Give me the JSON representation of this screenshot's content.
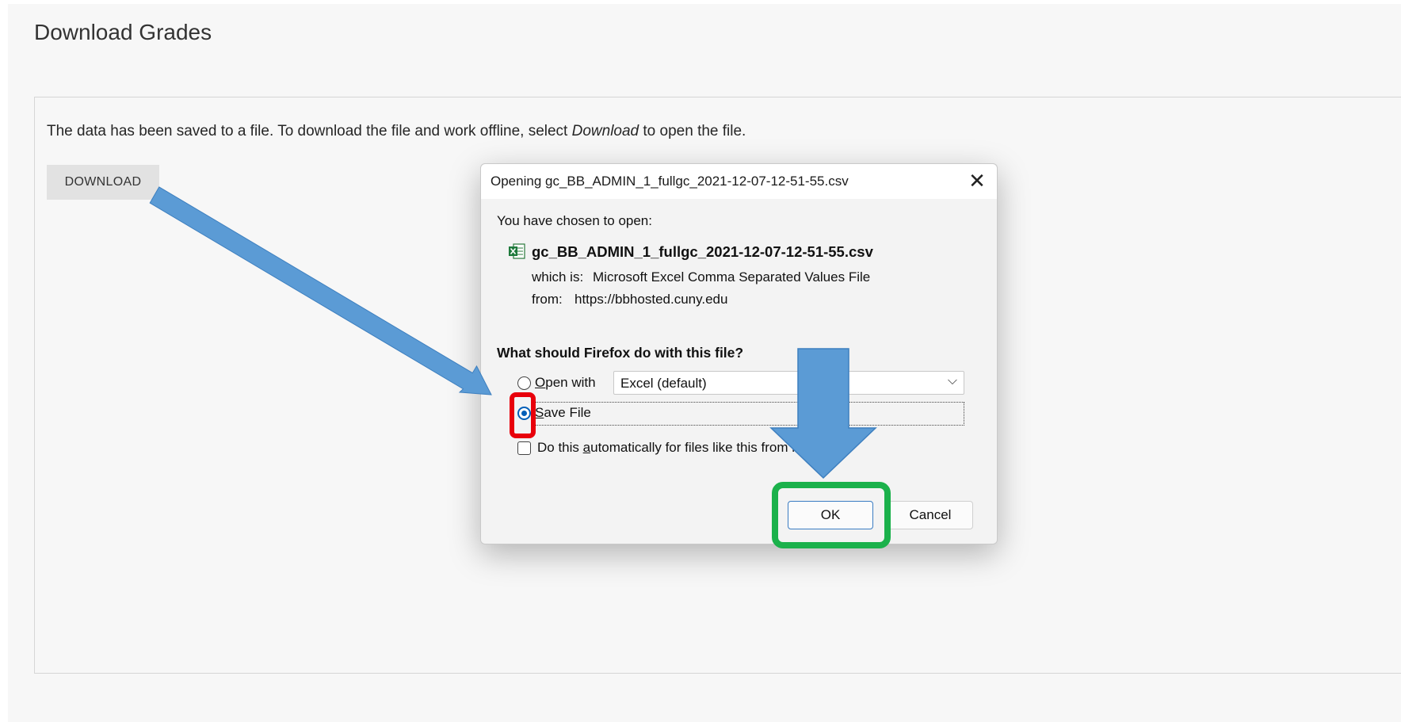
{
  "page": {
    "title": "Download Grades",
    "intro_before": "The data has been saved to a file. To download the file and work offline, select ",
    "intro_emphasis": "Download",
    "intro_after": " to open the file.",
    "download_label": "DOWNLOAD"
  },
  "dialog": {
    "title": "Opening gc_BB_ADMIN_1_fullgc_2021-12-07-12-51-55.csv",
    "close_glyph": "✕",
    "chosen_label": "You have chosen to open:",
    "file_icon": "excel-file-icon",
    "filename": "gc_BB_ADMIN_1_fullgc_2021-12-07-12-51-55.csv",
    "which_is_label": "which is:",
    "which_is_value": "Microsoft Excel Comma Separated Values File",
    "from_label": "from:",
    "from_value": "https://bbhosted.cuny.edu",
    "question": "What should Firefox do with this file?",
    "open_with_rest": "pen with",
    "open_with_access": "O",
    "open_with_app": "Excel (default)",
    "save_file_access": "S",
    "save_file_rest": "ave File",
    "save_file_selected": true,
    "auto_before": "Do this ",
    "auto_access": "a",
    "auto_after": "utomatically for files like this from now on.",
    "ok_label": "OK",
    "cancel_label": "Cancel"
  },
  "annotations": {
    "arrow_color": "#5b9bd5",
    "highlight_red": "#e8000b",
    "highlight_green": "#1bb14b"
  }
}
